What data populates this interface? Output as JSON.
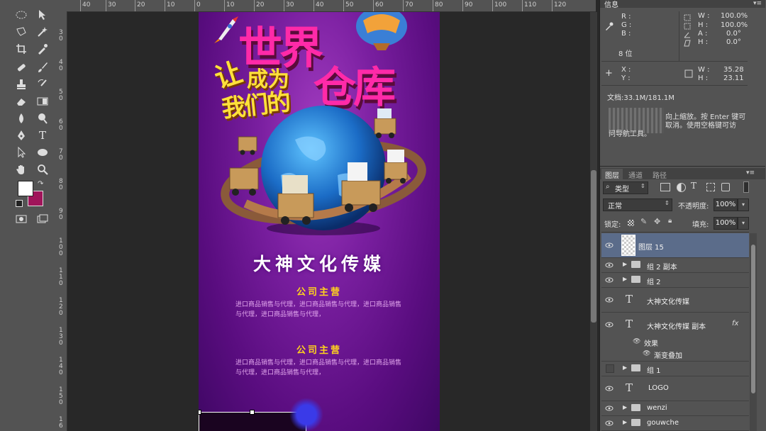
{
  "ruler": {
    "top_labels": [
      "40",
      "30",
      "20",
      "10",
      "0",
      "10",
      "20",
      "30",
      "40",
      "50",
      "60",
      "70",
      "80",
      "90",
      "100",
      "110",
      "120"
    ],
    "left_labels": [
      "3 0",
      "4 0",
      "5 0",
      "6 0",
      "7 0",
      "8 0",
      "9 0",
      "1 0 0",
      "1 1 0",
      "1 2 0",
      "1 3 0",
      "1 4 0",
      "1 5 0",
      "1 6"
    ]
  },
  "poster": {
    "headline_top": "世界",
    "headline_left": "让",
    "headline_mid": "成为",
    "headline_bottom": "我们的",
    "headline_right": "仓库",
    "company": "大神文化传媒",
    "section1_title": "公司主营",
    "section1_body": "进口商品销售与代理，进口商品销售与代理，进口商品销售与代理，进口商品销售与代理，",
    "section2_title": "公司主营",
    "section2_body": "进口商品销售与代理，进口商品销售与代理，进口商品销售与代理，进口商品销售与代理，"
  },
  "info_panel": {
    "tab": "信息",
    "r_label": "R :",
    "g_label": "G :",
    "b_label": "B :",
    "bit_depth": "8 位",
    "w_label": "W :",
    "w_value": "100.0%",
    "h_label": "H :",
    "h_value": "100.0%",
    "a_label": "A :",
    "a_value": "0.0°",
    "h2_label": "H :",
    "h2_value": "0.0°",
    "x_label": "X :",
    "y_label": "Y :",
    "w2_label": "W :",
    "w2_value": "35.28",
    "h3_label": "H :",
    "h3_value": "23.11",
    "doc": "文档:33.1M/181.1M",
    "hint_line1": "向上缩放。按 Enter 键可",
    "hint_line2": "取消。使用空格键可访",
    "hint_line3": "问导航工具。"
  },
  "layers_panel": {
    "tabs": [
      "图层",
      "通道",
      "路径"
    ],
    "filter_label": "类型",
    "blend_mode": "正常",
    "opacity_label": "不透明度:",
    "opacity_value": "100%",
    "lock_label": "锁定:",
    "fill_label": "填充:",
    "fill_value": "100%",
    "layers": [
      {
        "name": "图层 15",
        "kind": "pixel",
        "visible": true,
        "selected": true
      },
      {
        "name": "组 2 副本",
        "kind": "group",
        "visible": true
      },
      {
        "name": "组 2",
        "kind": "group",
        "visible": true
      },
      {
        "name": "大神文化传媒",
        "kind": "text",
        "visible": true
      },
      {
        "name": "大神文化传媒 副本",
        "kind": "text",
        "visible": true,
        "fx": "fx"
      },
      {
        "name": "效果",
        "kind": "effect"
      },
      {
        "name": "渐变叠加",
        "kind": "effect-item"
      },
      {
        "name": "组 1",
        "kind": "group",
        "visible": false
      },
      {
        "name": "LOGO",
        "kind": "text",
        "visible": true
      },
      {
        "name": "wenzi",
        "kind": "group",
        "visible": true
      },
      {
        "name": "gouwche",
        "kind": "group",
        "visible": true
      }
    ]
  },
  "colors": {
    "foreground": "#ffffff",
    "background": "#a0145a",
    "headline_pink": "#ff2aa8",
    "headline_yellow": "#ffe13a",
    "section_title": "#ffd21e",
    "body_text": "#e3a8ee"
  }
}
